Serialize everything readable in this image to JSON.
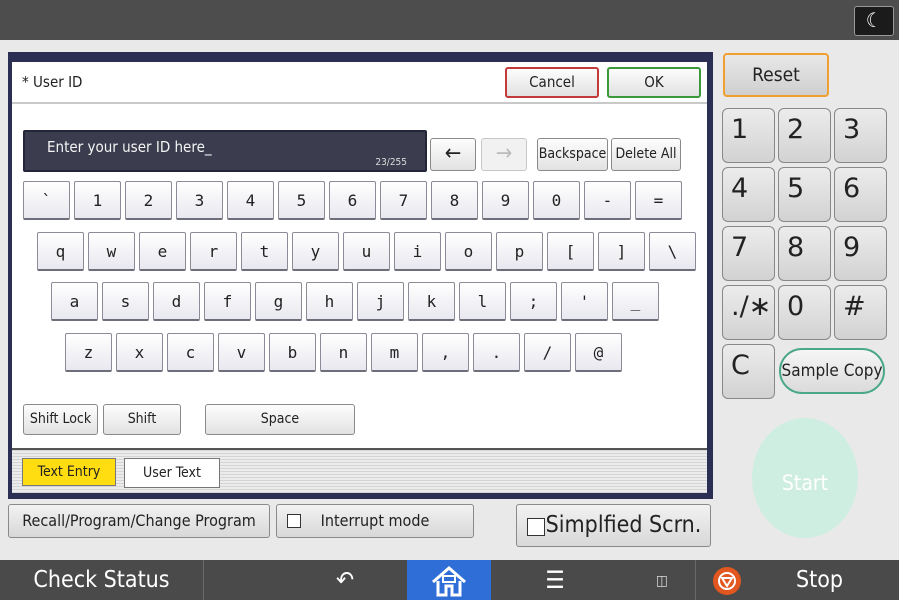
{
  "dialog": {
    "title": "* User ID",
    "cancel_label": "Cancel",
    "ok_label": "OK",
    "input_text": "Enter your user ID here_",
    "char_count": "23/255",
    "left_arrow": "←",
    "right_arrow": "→",
    "backspace_label": "Backspace",
    "delete_all_label": "Delete All",
    "shift_lock_label": "Shift Lock",
    "shift_label": "Shift",
    "space_label": "Space",
    "tabs": [
      {
        "label": "Text Entry"
      },
      {
        "label": "User Text"
      }
    ],
    "keyboard": {
      "row1": [
        "`",
        "1",
        "2",
        "3",
        "4",
        "5",
        "6",
        "7",
        "8",
        "9",
        "0",
        "-",
        "="
      ],
      "row2": [
        "q",
        "w",
        "e",
        "r",
        "t",
        "y",
        "u",
        "i",
        "o",
        "p",
        "[",
        "]",
        "\\"
      ],
      "row3": [
        "a",
        "s",
        "d",
        "f",
        "g",
        "h",
        "j",
        "k",
        "l",
        ";",
        "'",
        "_"
      ],
      "row4": [
        "z",
        "x",
        "c",
        "v",
        "b",
        "n",
        "m",
        ",",
        ".",
        "/",
        "@"
      ]
    }
  },
  "bottom_buttons": {
    "recall_label": "Recall/Program/Change Program",
    "interrupt_label": "Interrupt mode",
    "simplified_label": "Simplfied Scrn."
  },
  "right_panel": {
    "reset_label": "Reset",
    "numpad": [
      "1",
      "2",
      "3",
      "4",
      "5",
      "6",
      "7",
      "8",
      "9",
      "./∗",
      "0",
      "#"
    ],
    "clear_label": "C",
    "sample_copy_label": "Sample Copy",
    "start_label": "Start"
  },
  "status_bar": {
    "check_status_label": "Check Status",
    "stop_label": "Stop"
  },
  "colors": {
    "accent_tab": "#ffdd11",
    "home_button": "#2f6ed6",
    "reset_border": "#f0a030",
    "cancel_border": "#c23a3a",
    "ok_border": "#3a9a3a",
    "start": "#cfeee2"
  }
}
